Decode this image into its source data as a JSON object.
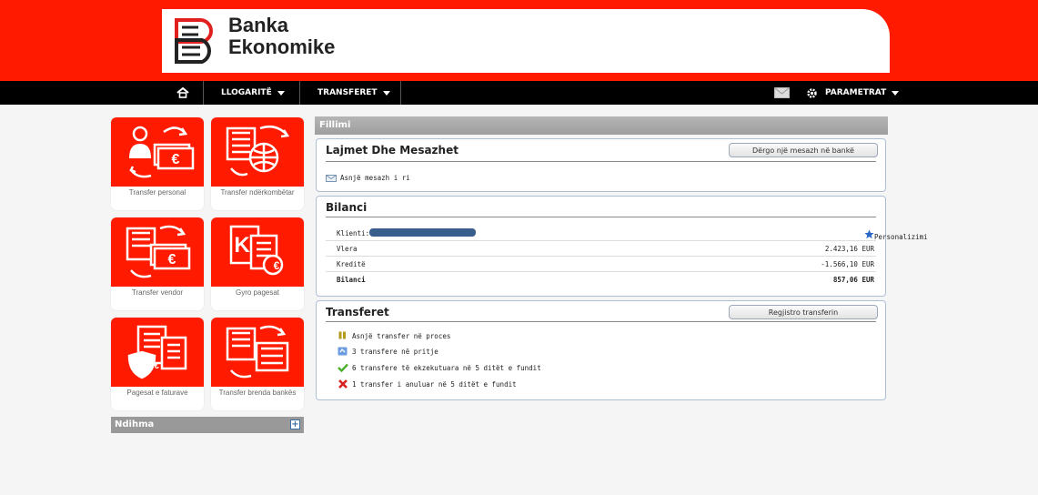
{
  "brand": {
    "line1": "Banka",
    "line2": "Ekonomike"
  },
  "nav": {
    "home_icon": "home-icon",
    "accounts": "LLOGARITË",
    "transfers": "TRANSFERET",
    "mail_icon": "envelope-icon",
    "settings_icon": "gear-icon",
    "parameters": "PARAMETRAT"
  },
  "tiles": [
    {
      "label": "Transfer personal",
      "icon": "person-euro-icon"
    },
    {
      "label": "Transfer ndërkombëtar",
      "icon": "bank-globe-icon"
    },
    {
      "label": "Transfer vendor",
      "icon": "bank-euro-icon"
    },
    {
      "label": "Gyro pagesat",
      "icon": "giro-payment-icon"
    },
    {
      "label": "Pagesat e faturave",
      "icon": "invoice-shield-icon"
    },
    {
      "label": "Transfer brenda bankës",
      "icon": "bank-to-bank-icon"
    }
  ],
  "help": {
    "title": "Ndihma"
  },
  "main": {
    "section_title": "Fillimi",
    "news": {
      "title": "Lajmet Dhe Mesazhet",
      "button": "Dërgo një mesazh në bankë",
      "empty": "Asnjë mesazh i ri"
    },
    "balance": {
      "title": "Bilanci",
      "client_label": "Klienti:",
      "personalize": "Personalizimi",
      "rows": [
        {
          "label": "Vlera",
          "value": "2.423,16 EUR"
        },
        {
          "label": "Kreditë",
          "value": "-1.566,10 EUR"
        },
        {
          "label": "Bilanci",
          "value": "857,06 EUR"
        }
      ]
    },
    "transfers": {
      "title": "Transferet",
      "button": "Regjistro transferin",
      "items": [
        {
          "text": "Asnjë transfer në proces",
          "icon": "pause-icon"
        },
        {
          "text": "3 transfere në pritje",
          "icon": "pending-icon"
        },
        {
          "text": "6 transfere të ekzekutuara në 5 ditët e fundit",
          "icon": "check-icon"
        },
        {
          "text": "1 transfer i anuluar në 5 ditët e fundit",
          "icon": "cross-icon"
        }
      ]
    }
  },
  "colors": {
    "brand_red": "#ff1a00",
    "nav_black": "#000000",
    "panel_border": "#aebfd3",
    "mask_blue": "#3a5e8c"
  }
}
